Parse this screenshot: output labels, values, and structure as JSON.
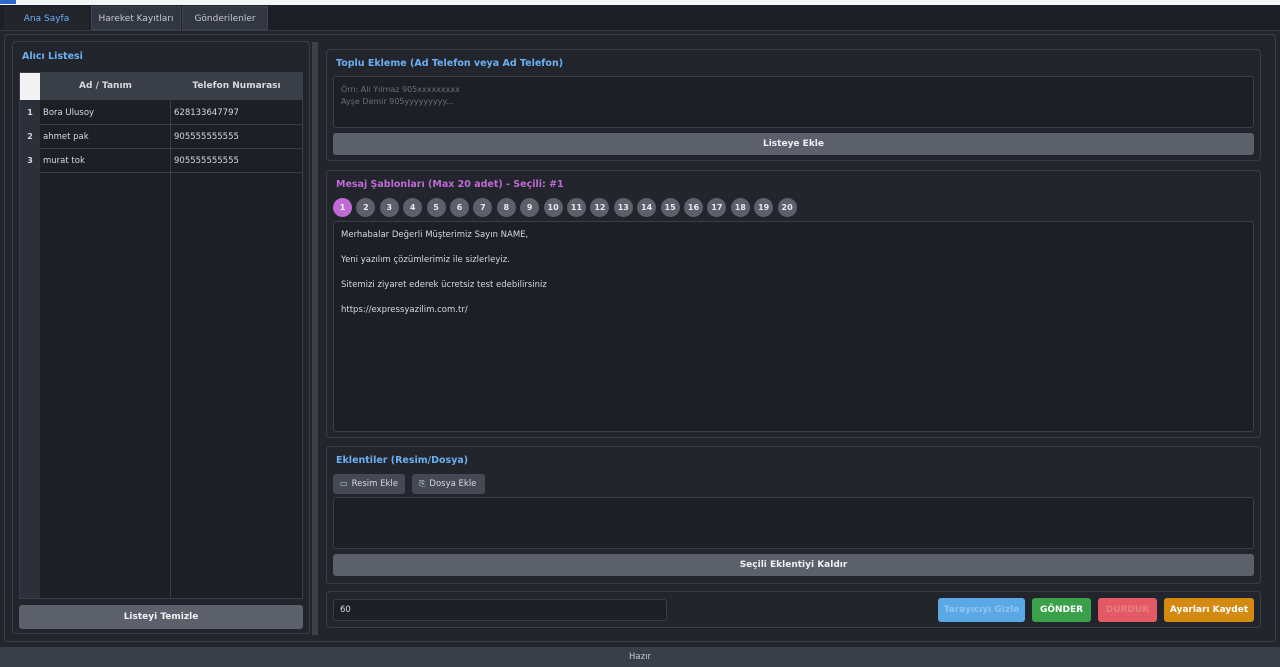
{
  "tabs": [
    "Ana Sayfa",
    "Hareket Kayıtları",
    "Gönderilenler"
  ],
  "left_panel": {
    "title": "Alıcı Listesi",
    "columns": [
      "Ad / Tanım",
      "Telefon Numarası"
    ],
    "rows": [
      {
        "index": "1",
        "name": "Bora Ulusoy",
        "phone": "628133647797"
      },
      {
        "index": "2",
        "name": "ahmet pak",
        "phone": "905555555555"
      },
      {
        "index": "3",
        "name": "murat tok",
        "phone": "905555555555"
      }
    ],
    "clear_button": "Listeyi Temizle"
  },
  "bulk_add": {
    "title": "Toplu Ekleme (Ad Telefon veya Ad Telefon)",
    "placeholder_line1": "Örn: Ali Yılmaz 905xxxxxxxxx",
    "placeholder_line2": "Ayşe Demir 905yyyyyyyyy...",
    "add_button": "Listeye Ekle"
  },
  "templates": {
    "title": "Mesaj Şablonları (Max 20 adet) - Seçili: #1",
    "numbers": [
      "1",
      "2",
      "3",
      "4",
      "5",
      "6",
      "7",
      "8",
      "9",
      "10",
      "11",
      "12",
      "13",
      "14",
      "15",
      "16",
      "17",
      "18",
      "19",
      "20"
    ],
    "selected": "1",
    "message_lines": [
      "Merhabalar Değerli Müşterimiz Sayın NAME,",
      "Yeni yazılım çözümlerimiz ile sizlerleyiz.",
      "Sitemizi ziyaret ederek ücretsiz test edebilirsiniz",
      "https://expressyazilim.com.tr/"
    ]
  },
  "attachments": {
    "title": "Eklentiler (Resim/Dosya)",
    "image_button": "Resim Ekle",
    "file_button": "Dosya Ekle",
    "remove_button": "Seçili Eklentiyi Kaldır"
  },
  "bottom": {
    "delay_value": "60",
    "hide_browser_button": "Tarayıcıyı Gizle",
    "send_button": "GÖNDER",
    "stop_button": "DURDUR",
    "save_button": "Ayarları Kaydet"
  },
  "status_text": "Hazır",
  "colors": {
    "accent_blue": "#6bb0f4",
    "template_purple": "#c06ad6",
    "send_green": "#3aa14a",
    "stop_red": "#e35a64",
    "save_orange": "#d48a10",
    "hide_blue": "#5aa8e6"
  }
}
